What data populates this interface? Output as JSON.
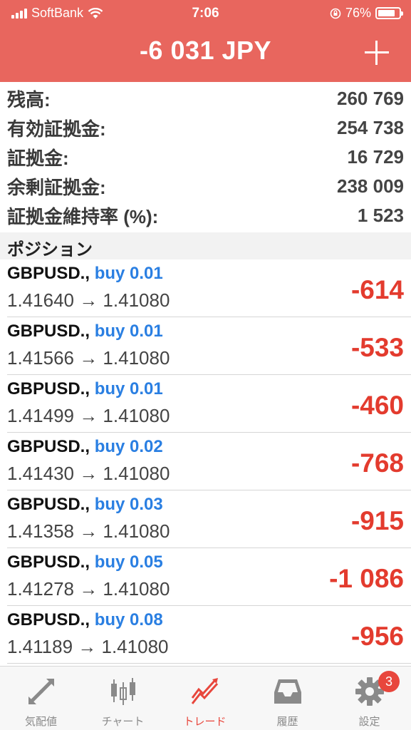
{
  "status_bar": {
    "carrier": "SoftBank",
    "time": "7:06",
    "battery": "76%"
  },
  "header": {
    "title": "-6 031 JPY"
  },
  "summary": [
    {
      "label": "残高:",
      "value": "260 769"
    },
    {
      "label": "有効証拠金:",
      "value": "254 738"
    },
    {
      "label": "証拠金:",
      "value": "16 729"
    },
    {
      "label": "余剰証拠金:",
      "value": "238 009"
    },
    {
      "label": "証拠金維持率 (%):",
      "value": "1 523"
    }
  ],
  "section_title": "ポジション",
  "positions": [
    {
      "symbol": "GBPUSD.,",
      "direction": "buy 0.01",
      "prices": "1.41640 → 1.41080",
      "profit": "-614"
    },
    {
      "symbol": "GBPUSD.,",
      "direction": "buy 0.01",
      "prices": "1.41566 → 1.41080",
      "profit": "-533"
    },
    {
      "symbol": "GBPUSD.,",
      "direction": "buy 0.01",
      "prices": "1.41499 → 1.41080",
      "profit": "-460"
    },
    {
      "symbol": "GBPUSD.,",
      "direction": "buy 0.02",
      "prices": "1.41430 → 1.41080",
      "profit": "-768"
    },
    {
      "symbol": "GBPUSD.,",
      "direction": "buy 0.03",
      "prices": "1.41358 → 1.41080",
      "profit": "-915"
    },
    {
      "symbol": "GBPUSD.,",
      "direction": "buy 0.05",
      "prices": "1.41278 → 1.41080",
      "profit": "-1 086"
    },
    {
      "symbol": "GBPUSD.,",
      "direction": "buy 0.08",
      "prices": "1.41189 → 1.41080",
      "profit": "-956"
    }
  ],
  "tabs": [
    {
      "label": "気配値",
      "icon": "quotes-arrows-icon"
    },
    {
      "label": "チャート",
      "icon": "candlestick-chart-icon"
    },
    {
      "label": "トレード",
      "icon": "trade-chart-icon",
      "active": true
    },
    {
      "label": "履歴",
      "icon": "history-inbox-icon"
    },
    {
      "label": "設定",
      "icon": "gear-icon",
      "badge": "3"
    }
  ],
  "colors": {
    "header": "#e8665e",
    "profit_negative": "#e33b2e",
    "buy": "#2a7fe2",
    "active_tab": "#e8463c"
  }
}
